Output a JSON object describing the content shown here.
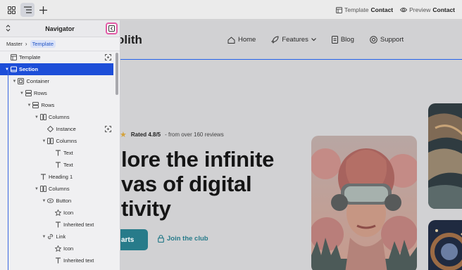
{
  "toolbar": {
    "template_label": "Template",
    "template_value": "Contact",
    "preview_label": "Preview",
    "preview_value": "Contact"
  },
  "navigator": {
    "title": "Navigator",
    "breadcrumb": [
      "Master",
      "Template"
    ],
    "tree": [
      {
        "label": "Template",
        "icon": "template-icon",
        "depth": 0,
        "arrow": false,
        "selected": false,
        "action_icon": "focus-icon"
      },
      {
        "label": "Section",
        "icon": "section-icon",
        "depth": 0,
        "arrow": true,
        "selected": true
      },
      {
        "label": "Container",
        "icon": "container-icon",
        "depth": 1,
        "arrow": true,
        "selected": false
      },
      {
        "label": "Rows",
        "icon": "rows-icon",
        "depth": 2,
        "arrow": true,
        "selected": false
      },
      {
        "label": "Rows",
        "icon": "rows-icon",
        "depth": 3,
        "arrow": true,
        "selected": false
      },
      {
        "label": "Columns",
        "icon": "columns-icon",
        "depth": 4,
        "arrow": true,
        "selected": false
      },
      {
        "label": "Instance",
        "icon": "instance-icon",
        "depth": 5,
        "arrow": false,
        "selected": false,
        "action_icon": "focus-icon"
      },
      {
        "label": "Columns",
        "icon": "columns-icon",
        "depth": 5,
        "arrow": true,
        "selected": false
      },
      {
        "label": "Text",
        "icon": "text-icon",
        "depth": 6,
        "arrow": false,
        "selected": false
      },
      {
        "label": "Text",
        "icon": "text-icon",
        "depth": 6,
        "arrow": false,
        "selected": false
      },
      {
        "label": "Heading 1",
        "icon": "text-icon",
        "depth": 4,
        "arrow": false,
        "selected": false
      },
      {
        "label": "Columns",
        "icon": "columns-icon",
        "depth": 4,
        "arrow": true,
        "selected": false
      },
      {
        "label": "Button",
        "icon": "button-icon",
        "depth": 5,
        "arrow": true,
        "selected": false
      },
      {
        "label": "Icon",
        "icon": "star-icon",
        "depth": 6,
        "arrow": false,
        "selected": false
      },
      {
        "label": "Inherited text",
        "icon": "text-icon",
        "depth": 6,
        "arrow": false,
        "selected": false
      },
      {
        "label": "Link",
        "icon": "link-icon",
        "depth": 5,
        "arrow": true,
        "selected": false
      },
      {
        "label": "Icon",
        "icon": "star-icon",
        "depth": 6,
        "arrow": false,
        "selected": false
      },
      {
        "label": "Inherited text",
        "icon": "text-icon",
        "depth": 6,
        "arrow": false,
        "selected": false
      }
    ]
  },
  "site": {
    "brand": "olith",
    "nav": [
      {
        "label": "Home",
        "icon": "home-icon"
      },
      {
        "label": "Features",
        "icon": "rocket-icon"
      },
      {
        "label": "Blog",
        "icon": "document-icon"
      },
      {
        "label": "Support",
        "icon": "lifebuoy-icon"
      }
    ],
    "rating_score": "Rated 4.8/5",
    "rating_rest": "- from over 160 reviews",
    "hero_line1": "lore the infinite",
    "hero_line2": "vas of digital",
    "hero_line3": "tivity",
    "cta_label": "arts",
    "join_label": "Join the club"
  },
  "colors": {
    "selection": "#1d4ed8",
    "accent_teal": "#277b8a",
    "highlight_pink": "#e35ca8"
  }
}
